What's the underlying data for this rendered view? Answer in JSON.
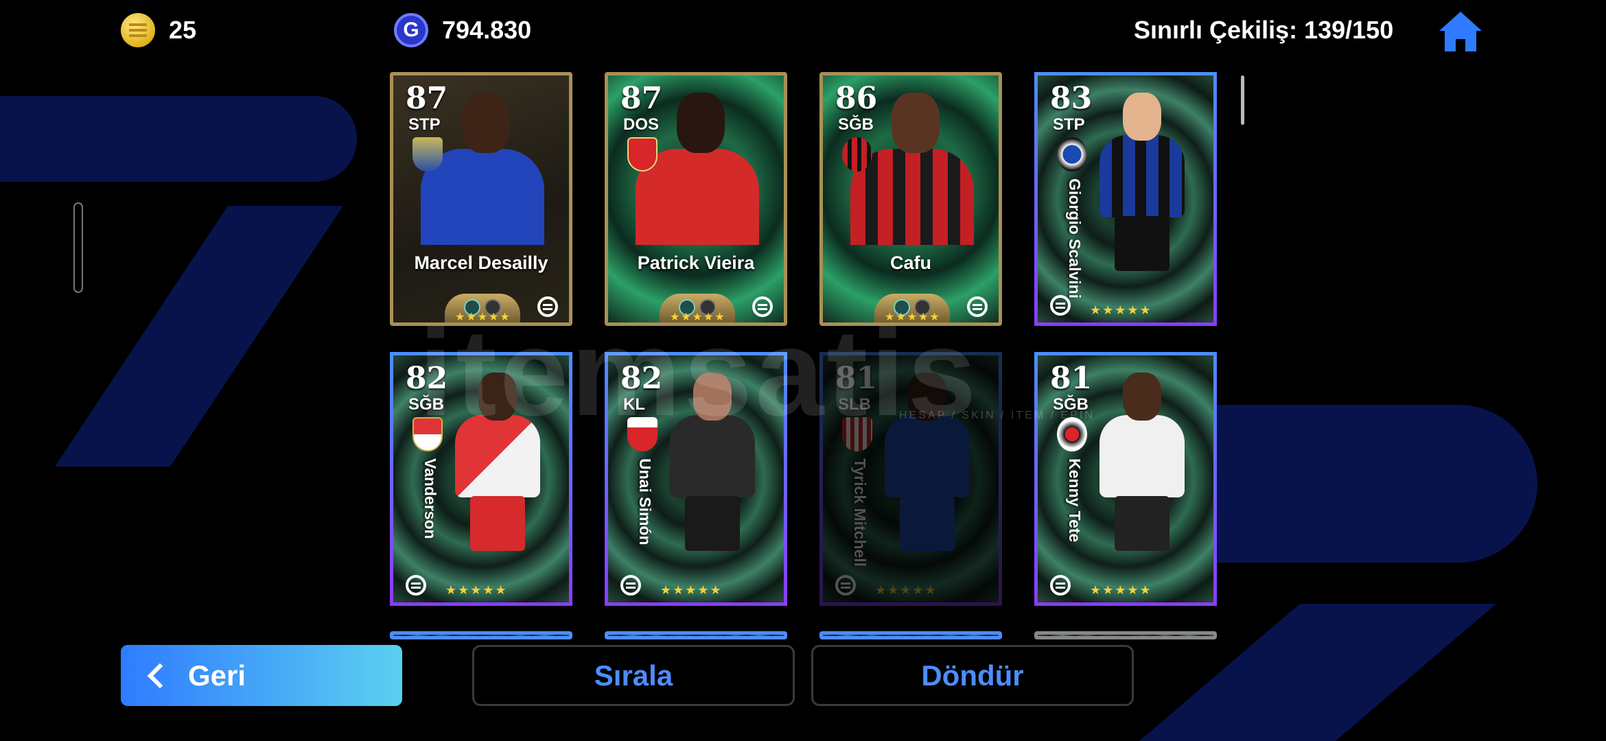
{
  "header": {
    "coins": "25",
    "gp": "794.830",
    "limited_draw": "Sınırlı Çekiliş: 139/150"
  },
  "cards": [
    {
      "rating": "87",
      "position": "STP",
      "name": "Marcel Desailly",
      "style": "gold",
      "kit": "#2244bb"
    },
    {
      "rating": "87",
      "position": "DOS",
      "name": "Patrick Vieira",
      "style": "gold-green",
      "kit": "#d42a2a"
    },
    {
      "rating": "86",
      "position": "SĞB",
      "name": "Cafu",
      "style": "gold-green",
      "kit": "#c41f25"
    },
    {
      "rating": "83",
      "position": "STP",
      "name": "Giorgio Scalvini",
      "style": "blue",
      "kit": "#1a3a9c"
    },
    {
      "rating": "82",
      "position": "SĞB",
      "name": "Vanderson",
      "style": "blue",
      "kit": "#e13436"
    },
    {
      "rating": "82",
      "position": "KL",
      "name": "Unai Simón",
      "style": "blue",
      "kit": "#2a2a2a"
    },
    {
      "rating": "81",
      "position": "SLB",
      "name": "Tyrick Mitchell",
      "style": "blue-dim",
      "kit": "#1f4fb0"
    },
    {
      "rating": "81",
      "position": "SĞB",
      "name": "Kenny Tete",
      "style": "blue",
      "kit": "#f0f0f0"
    }
  ],
  "stars": "★★★★★",
  "watermark": {
    "text": "itemsatis",
    "sub": "HESAP / SKIN / ITEM / EPIN"
  },
  "buttons": {
    "back": "Geri",
    "sort": "Sırala",
    "rotate": "Döndür"
  },
  "colors": {
    "accent": "#4d8dff",
    "gold_border": "#a89155",
    "star": "#f3d23b"
  }
}
